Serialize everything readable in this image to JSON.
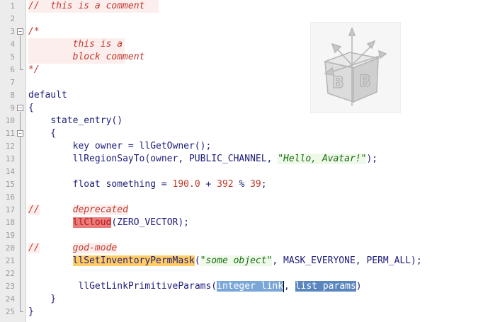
{
  "editor": {
    "lines": [
      {
        "n": "1"
      },
      {
        "n": "2"
      },
      {
        "n": "3"
      },
      {
        "n": "4"
      },
      {
        "n": "5"
      },
      {
        "n": "6"
      },
      {
        "n": "7"
      },
      {
        "n": "8"
      },
      {
        "n": "9"
      },
      {
        "n": "10"
      },
      {
        "n": "11"
      },
      {
        "n": "12"
      },
      {
        "n": "13"
      },
      {
        "n": "14"
      },
      {
        "n": "15"
      },
      {
        "n": "16"
      },
      {
        "n": "17"
      },
      {
        "n": "18"
      },
      {
        "n": "19"
      },
      {
        "n": "20"
      },
      {
        "n": "21"
      },
      {
        "n": "22"
      },
      {
        "n": "23"
      },
      {
        "n": "24"
      },
      {
        "n": "25"
      }
    ],
    "code": {
      "l1_comment": "//  this is a comment",
      "l3_open": "/*",
      "l4_text": "        this is a",
      "l5_text": "        block comment",
      "l6_close": "*/",
      "l8_default": "default",
      "l9_brace": "{",
      "l10_indent": "    ",
      "l10_state": "state_entry()",
      "l11_brace": "    {",
      "l12_indent": "        ",
      "l12_key": "key owner = llGetOwner();",
      "l13_indent": "        ",
      "l13_fn": "llRegionSayTo(owner, PUBLIC_CHANNEL, ",
      "l13_str": "\"Hello, Avatar!\"",
      "l13_end": ");",
      "l15_indent": "        ",
      "l15_a": "float something = ",
      "l15_n1": "190.0",
      "l15_b": " + ",
      "l15_n2": "392",
      "l15_c": " % ",
      "l15_n3": "39",
      "l15_d": ";",
      "l17_slash": "//",
      "l17_gap": "      ",
      "l17_word": "deprecated",
      "l18_indent": "        ",
      "l18_fn": "llCloud",
      "l18_rest": "(ZERO_VECTOR);",
      "l20_slash": "//",
      "l20_gap": "      ",
      "l20_word": "god-mode",
      "l21_indent": "        ",
      "l21_fn": "llSetInventoryPermMask",
      "l21_paren": "(",
      "l21_str": "\"some object\"",
      "l21_rest": ", MASK_EVERYONE, PERM_ALL);",
      "l23_indent": "         ",
      "l23_fn": "llGetLinkPrimitiveParams(",
      "l23_p1": "integer link",
      "l23_comma": ", ",
      "l23_p2": "list params",
      "l23_end": ")",
      "l24_brace": "    }",
      "l25_brace": "}"
    },
    "logo": {
      "letters": [
        "B",
        "B"
      ],
      "icon": "building-blocks-cube-logo"
    },
    "colors": {
      "comment": "#c0392b",
      "string": "#186b12",
      "number": "#c0392b",
      "identifier": "#1c1c7a",
      "deprecated_highlight": "#e97b7b",
      "godmode_highlight": "#ffcc66",
      "param_highlight": "#7aa6d8",
      "gutter": "#ececec"
    }
  }
}
